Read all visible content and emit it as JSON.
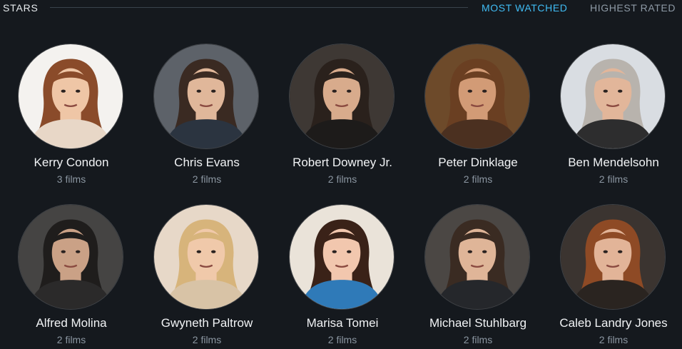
{
  "section": {
    "title": "STARS",
    "sort_tabs": [
      {
        "label": "MOST WATCHED",
        "active": true
      },
      {
        "label": "HIGHEST RATED",
        "active": false
      }
    ]
  },
  "stars": [
    {
      "name": "Kerry Condon",
      "films": "3 films",
      "photo": {
        "bg": "#f4f2ef",
        "skin": "#efc6a6",
        "hair": "#8a4b2a",
        "shirt": "#e8d7c7"
      }
    },
    {
      "name": "Chris Evans",
      "films": "2 films",
      "photo": {
        "bg": "#5d6269",
        "skin": "#e0b79a",
        "hair": "#3a2a22",
        "shirt": "#2b3440"
      }
    },
    {
      "name": "Robert Downey Jr.",
      "films": "2 films",
      "photo": {
        "bg": "#3e3834",
        "skin": "#d8ab8c",
        "hair": "#2a211c",
        "shirt": "#1d1b1a"
      }
    },
    {
      "name": "Peter Dinklage",
      "films": "2 films",
      "photo": {
        "bg": "#6d4a2a",
        "skin": "#d29b76",
        "hair": "#6a3f22",
        "shirt": "#4b3020"
      }
    },
    {
      "name": "Ben Mendelsohn",
      "films": "2 films",
      "photo": {
        "bg": "#d9dde2",
        "skin": "#e2b69a",
        "hair": "#b8b3ad",
        "shirt": "#2d2d2e"
      }
    },
    {
      "name": "Alfred Molina",
      "films": "2 films",
      "photo": {
        "bg": "#454443",
        "skin": "#caa186",
        "hair": "#1f1d1c",
        "shirt": "#2b2a2a"
      }
    },
    {
      "name": "Gwyneth Paltrow",
      "films": "2 films",
      "photo": {
        "bg": "#e7d8c8",
        "skin": "#f0c9aa",
        "hair": "#d7b47b",
        "shirt": "#d8c3a6"
      }
    },
    {
      "name": "Marisa Tomei",
      "films": "2 films",
      "photo": {
        "bg": "#eae3d9",
        "skin": "#f2c7ae",
        "hair": "#3a2218",
        "shirt": "#2f7ab8"
      }
    },
    {
      "name": "Michael Stuhlbarg",
      "films": "2 films",
      "photo": {
        "bg": "#4b4744",
        "skin": "#dfb598",
        "hair": "#3a2b22",
        "shirt": "#25272b"
      }
    },
    {
      "name": "Caleb Landry Jones",
      "films": "2 films",
      "photo": {
        "bg": "#3b3430",
        "skin": "#e2b498",
        "hair": "#8e4a25",
        "shirt": "#2a2420"
      }
    }
  ]
}
